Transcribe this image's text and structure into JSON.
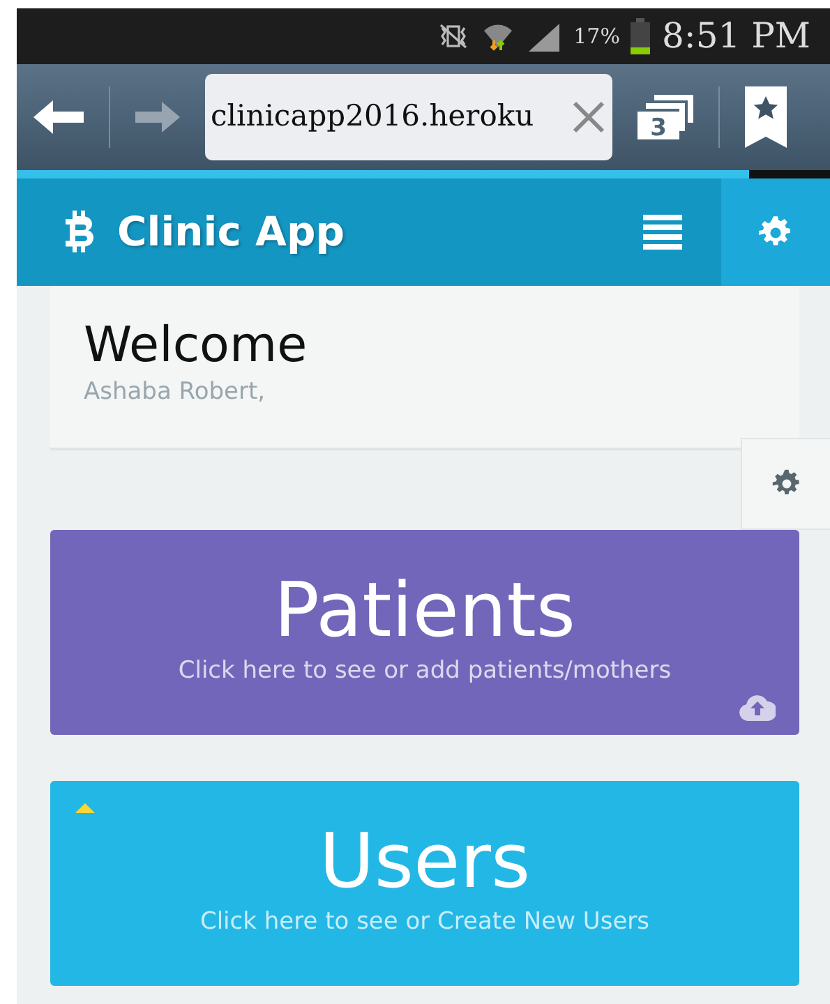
{
  "status_bar": {
    "battery": "17%",
    "time": "8:51 PM"
  },
  "browser": {
    "url": "clinicapp2016.heroku",
    "tab_count": "3",
    "loading": {
      "level": 0.9
    }
  },
  "app_bar": {
    "title": "Clinic App"
  },
  "welcome": {
    "title": "Welcome",
    "subtitle": "Ashaba Robert,"
  },
  "tiles": [
    {
      "title": "Patients",
      "subtitle": "Click here to see or add patients/mothers",
      "color": "#7266ba"
    },
    {
      "title": "Users",
      "subtitle": "Click here to see or Create New Users",
      "color": "#23b7e5"
    }
  ]
}
